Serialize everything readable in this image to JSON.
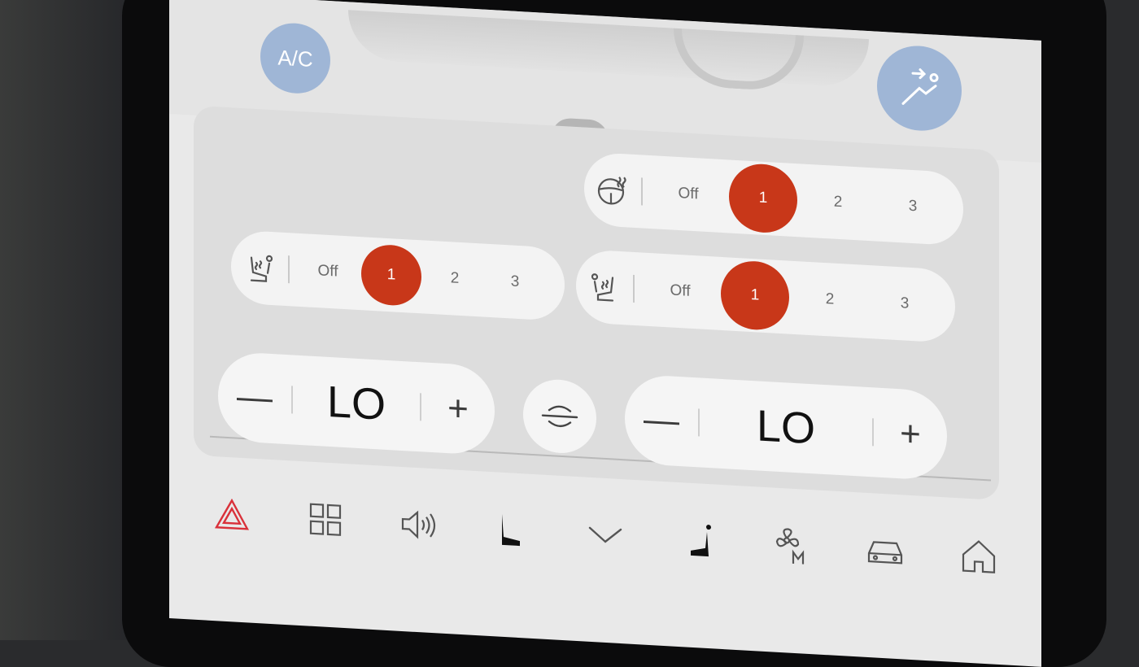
{
  "climate": {
    "ac_label": "A/C",
    "steering_heat": {
      "options": [
        "Off",
        "1",
        "2",
        "3"
      ],
      "selected": "1"
    },
    "driver_seat_heat": {
      "options": [
        "Off",
        "1",
        "2",
        "3"
      ],
      "selected": "1"
    },
    "passenger_seat_heat": {
      "options": [
        "Off",
        "1",
        "2",
        "3"
      ],
      "selected": "1"
    },
    "driver_temp": {
      "value": "LO",
      "minus": "—",
      "plus": "+"
    },
    "passenger_temp": {
      "value": "LO",
      "minus": "—",
      "plus": "+"
    }
  },
  "dock": {
    "items": [
      "hazard-icon",
      "apps-grid-icon",
      "volume-icon",
      "driver-seat-icon",
      "chevron-down-icon",
      "passenger-seat-icon",
      "fan-mode-icon",
      "car-icon",
      "home-icon"
    ]
  },
  "colors": {
    "accent": "#c83719",
    "ac_button": "#9fb6d6",
    "hazard": "#d9313a"
  }
}
